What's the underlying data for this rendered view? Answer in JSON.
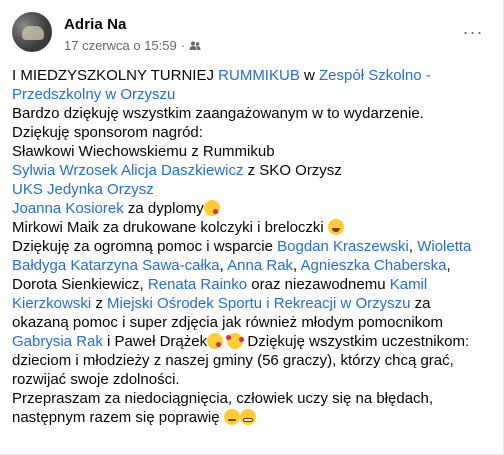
{
  "post": {
    "author": "Adria Na",
    "date": "17 czerwca o 15:59",
    "separator": "·",
    "audience_icon": "friends-icon",
    "menu_label": "···"
  },
  "body": {
    "l1_a": "I MIEDZYSZKOLNY TURNIEJ ",
    "l1_link1": "RUMMIKUB",
    "l1_b": " w ",
    "l1_link2": "Zespół Szkolno - Przedszkolny w Orzyszu",
    "l2": "Bardzo dziękuję wszystkim zaangażowanym w to wydarzenie.",
    "l3": "Dziękuję sponsorom nagród:",
    "l4": "Sławkowi Wiechowskiemu z Rummikub",
    "l5_link1": "Sylwia Wrzosek",
    "l5_gap": "  ",
    "l5_link2": "Alicja Daszkiewicz",
    "l5_b": " z SKO Orzysz",
    "l6_link": "UKS Jedynka Orzysz",
    "l7_link": "Joanna Kosiorek",
    "l7_b": "  za dyplomy",
    "l8": "Mirkowi Maik za drukowane kolczyki i breloczki ",
    "l9_a": "Dziękuję za ogromną pomoc i wsparcie ",
    "l9_link1": "Bogdan Kraszewski",
    "l9_b": ", ",
    "l9_link2": "Wioletta Bałdyga",
    "l9_gap": "  ",
    "l9_link3": "Katarzyna Sawa-całka",
    "l9_c": ", ",
    "l9_link4": "Anna Rak",
    "l9_d": ", ",
    "l9_link5": "Agnieszka Chaberska",
    "l9_e": ", Dorota Sienkiewicz, ",
    "l9_link6": "Renata Rainko",
    "l9_f": " oraz niezawodnemu ",
    "l9_link7": "Kamil Kierzkowski",
    "l9_g": "  z ",
    "l9_link8": "Miejski Ośrodek Sportu i Rekreacji w Orzyszu",
    "l9_h": " za okazaną pomoc i super zdjęcia jak również młodym  pomocnikom ",
    "l9_link9": "Gabrysia Rak",
    "l9_i": " i Paweł Drążek",
    "l9_j": " Dziękuję wszystkim uczestnikom: dzieciom i młodzieży z naszej gminy (56 graczy), którzy  chcą grać, rozwijać swoje zdolności.",
    "l10": "Przepraszam za niedociągnięcia, człowiek uczy się na błędach, następnym razem się poprawię "
  },
  "emoji": [
    "kissing-heart-emoji",
    "grinning-emoji",
    "smiling-hearts-emoji",
    "wink-emoji",
    "grimace-emoji"
  ]
}
